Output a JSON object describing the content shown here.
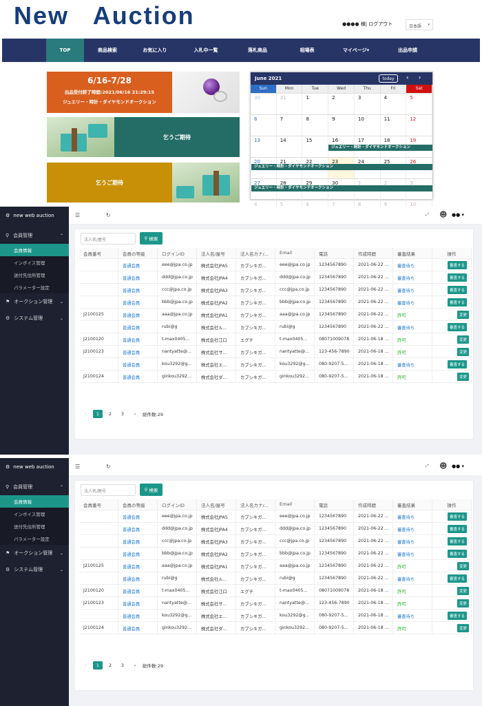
{
  "site": {
    "logo": "New   Auction",
    "user_label": "●●●● 様| ログアウト",
    "lang": "日本語",
    "nav": [
      {
        "label": "TOP",
        "active": true
      },
      {
        "label": "商品検索"
      },
      {
        "label": "お気に入り"
      },
      {
        "label": "入札中一覧"
      },
      {
        "label": "落札商品"
      },
      {
        "label": "相場表"
      },
      {
        "label": "マイページ▾"
      },
      {
        "label": "出品申請"
      }
    ],
    "banner1": {
      "dates": "6/16-7/28",
      "line1": "出品受付終了時間:2021/06/16 21:29:15",
      "line2": "ジュエリー・時計・ダイヤモンドオークション"
    },
    "banner_teal": "乞うご期待",
    "banner_gold": "乞うご期待"
  },
  "calendar": {
    "title": "June 2021",
    "today_btn": "today",
    "prev": "‹",
    "next": "›",
    "days": [
      "Sun",
      "Mon",
      "Tue",
      "Wed",
      "Thu",
      "Fri",
      "Sat"
    ],
    "day_colors": [
      "#2f6ec4",
      "#888888",
      "#888888",
      "#888888",
      "#888888",
      "#888888",
      "#d11111"
    ],
    "weeks": [
      [
        "30",
        "31",
        "1",
        "2",
        "3",
        "4",
        "5"
      ],
      [
        "6",
        "7",
        "8",
        "9",
        "10",
        "11",
        "12"
      ],
      [
        "13",
        "14",
        "15",
        "16",
        "17",
        "18",
        "19"
      ],
      [
        "20",
        "21",
        "22",
        "23",
        "24",
        "25",
        "26"
      ],
      [
        "27",
        "28",
        "29",
        "30",
        "1",
        "2",
        "3"
      ],
      [
        "4",
        "5",
        "6",
        "7",
        "8",
        "9",
        "10"
      ]
    ],
    "event": "ジュエリー・時計・ダイヤモンドオークション"
  },
  "admin": {
    "brand": "new web auction",
    "menu": {
      "member_group": "会員管理",
      "items": [
        "会員情報",
        "インボイス管理",
        "送付先住所管理",
        "パラメーター設定"
      ],
      "auction_group": "オークション管理",
      "system_group": "システム管理"
    },
    "user": "●●",
    "search_placeholder": "法人名/屋号",
    "search_btn": "検索",
    "columns": [
      "会員番号",
      "会員の等級",
      "ログインID",
      "法人名/屋号",
      "法人名カナ/...",
      "Email",
      "電話",
      "作成時間",
      "審査結果",
      "操作"
    ],
    "rows": [
      [
        "",
        "普通会員",
        "eee@jpa.co.jp",
        "株式会社JPA5",
        "カブシキガ...",
        "eee@jpa.co.jp",
        "1234567890",
        "2021-06-22 ...",
        "審査待ち",
        "審査する"
      ],
      [
        "",
        "普通会員",
        "ddd@jpa.co.jp",
        "株式会社JPA4",
        "カブシキガ...",
        "ddd@jpa.co.jp",
        "1234567890",
        "2021-06-22 ...",
        "審査待ち",
        "審査する"
      ],
      [
        "",
        "普通会員",
        "ccc@jpa.co.jp",
        "株式会社JPA3",
        "カブシキガ...",
        "ccc@jpa.co.jp",
        "1234567890",
        "2021-06-22 ...",
        "審査待ち",
        "審査する"
      ],
      [
        "",
        "普通会員",
        "bbb@jpa.co.jp",
        "株式会社JPA2",
        "カブシキガ...",
        "bbb@jpa.co.jp",
        "1234567890",
        "2021-06-22 ...",
        "審査待ち",
        "審査する"
      ],
      [
        "J2100125",
        "普通会員",
        "aaa@jpa.co.jp",
        "株式会社JPA1",
        "カブシキガ...",
        "aaa@jpa.co.jp",
        "1234567890",
        "2021-06-22 ...",
        "許可",
        "変更"
      ],
      [
        "",
        "普通会員",
        "rubi@g",
        "株式会社ル...",
        "カブシキガ...",
        "rubi@g",
        "1234567890",
        "2021-06-22 ...",
        "審査待ち",
        "審査する"
      ],
      [
        "J2100120",
        "普通会員",
        "t-max0405...",
        "株式会社江口",
        "エグチ",
        "t-max0405...",
        "08071009078",
        "2021-06-18 ...",
        "許可",
        "変更"
      ],
      [
        "J2100123",
        "普通会員",
        "nantyatte@...",
        "株式会社サ...",
        "カブシキガ...",
        "nantyatte@...",
        "123-456-7890",
        "2021-06-18 ...",
        "許可",
        "変更"
      ],
      [
        "",
        "普通会員",
        "kou3292@g...",
        "株式会社エ...",
        "カブシキガ...",
        "kou3292@g...",
        "080-9207-5...",
        "2021-06-18 ...",
        "審査待ち",
        "審査する"
      ],
      [
        "J2100124",
        "普通会員",
        "ginkou3292...",
        "株式会社ダ...",
        "カブシキガ...",
        "ginkou3292...",
        "080-9207-5...",
        "2021-06-18 ...",
        "許可",
        "変更"
      ]
    ],
    "pager": {
      "prev": "‹",
      "pages": [
        "1",
        "2",
        "3"
      ],
      "next": "›",
      "total": "総件数:29"
    },
    "colors": {
      "accent": "#1d968a",
      "sidebar": "#1e2230",
      "nav": "#273566"
    }
  }
}
